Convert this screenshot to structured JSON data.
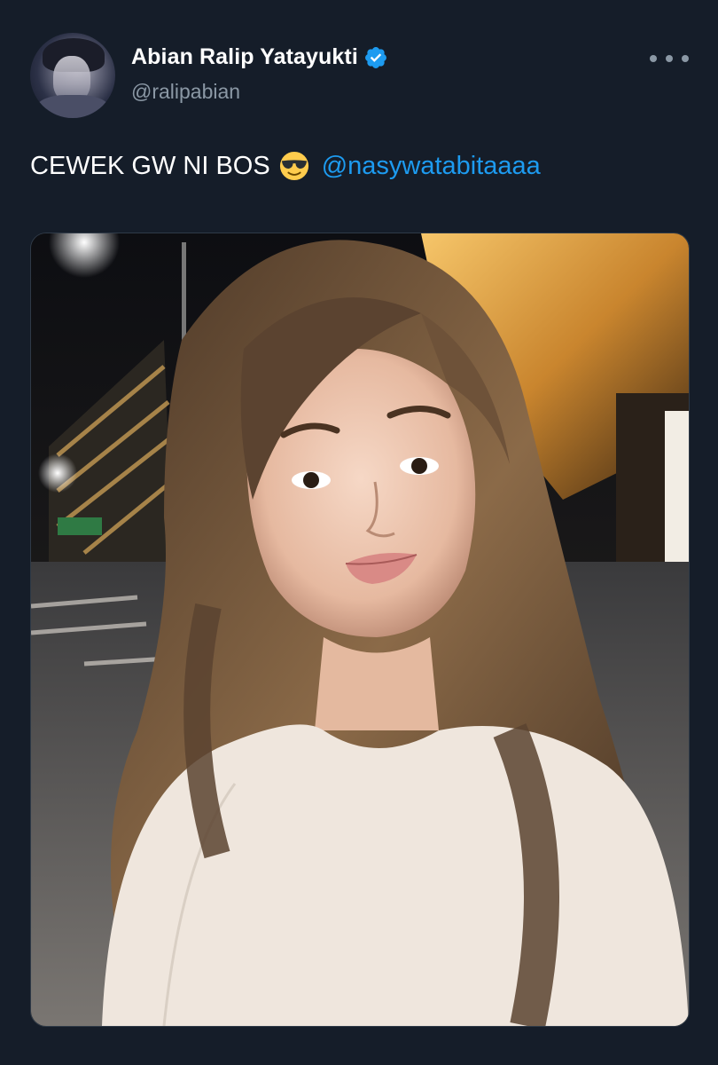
{
  "author": {
    "display_name": "Abian Ralip Yatayukti",
    "handle": "@ralipabian",
    "verified": true,
    "avatar_icon": "user-avatar"
  },
  "more_icon": "ellipsis-icon",
  "tweet": {
    "text": "CEWEK GW NI BOS",
    "emoji": "smiling-face-with-sunglasses",
    "mention": "@nasywatabitaaaa"
  },
  "colors": {
    "background": "#151d29",
    "accent": "#1d9bf0",
    "secondary_text": "#8b98a5",
    "verified_badge": "#1d9bf0"
  }
}
